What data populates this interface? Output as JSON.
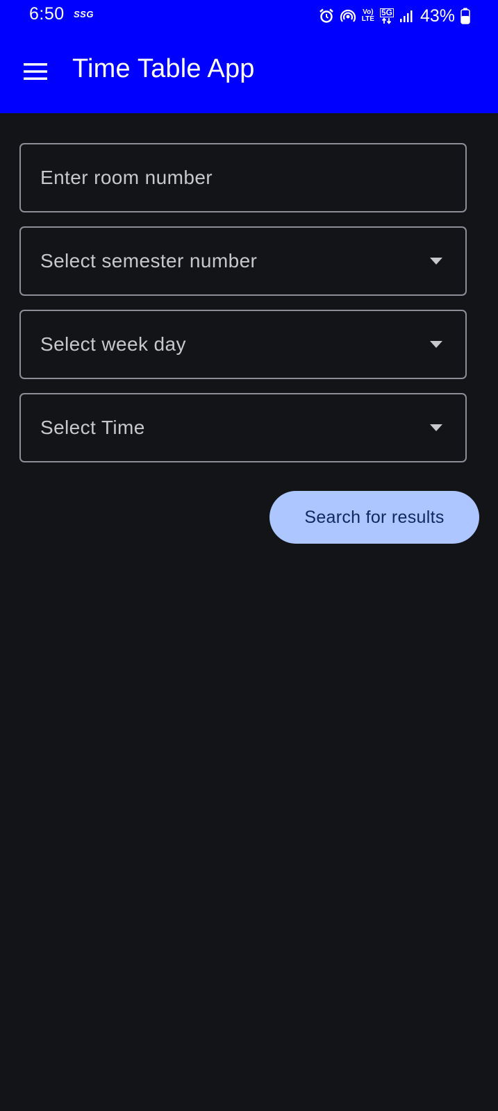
{
  "status_bar": {
    "time": "6:50",
    "carrier": "SSG",
    "network_label_top": "Vo)",
    "network_label_bottom": "LTE",
    "network_type": "5G",
    "battery": "43%"
  },
  "app_bar": {
    "title": "Time Table App",
    "menu_icon": "hamburger-menu-icon"
  },
  "form": {
    "room_input": {
      "placeholder": "Enter room number",
      "value": ""
    },
    "semester_select": {
      "label": "Select semester number"
    },
    "weekday_select": {
      "label": "Select week day"
    },
    "time_select": {
      "label": "Select Time"
    },
    "search_button": {
      "label": "Search for results"
    }
  },
  "colors": {
    "app_bar": "#0000ff",
    "background": "#131417",
    "button": "#adc6ff",
    "button_text": "#0d2a5c",
    "field_border": "#8c8f96"
  }
}
